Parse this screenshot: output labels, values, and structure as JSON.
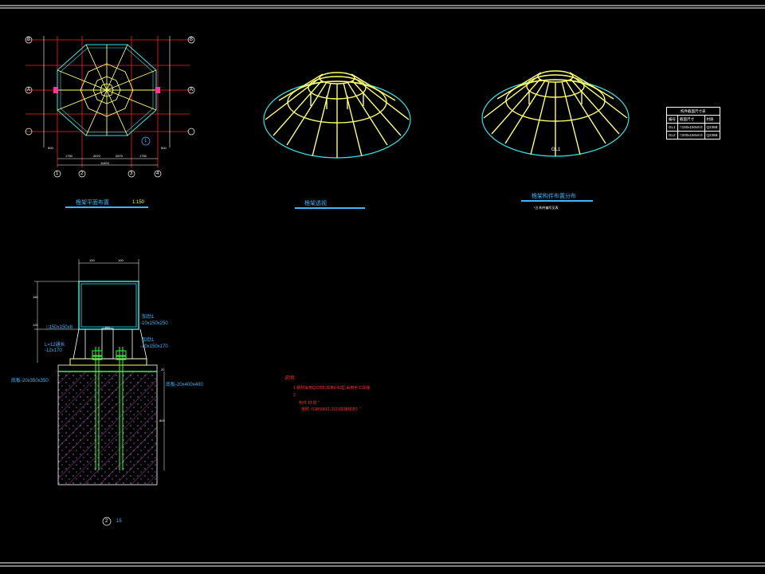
{
  "colors": {
    "background": "#000000",
    "grid_line": "#ff0000",
    "structure": "#ffff66",
    "outline": "#2ee6e6",
    "text": "#ffffff",
    "title": "#3fb6ff",
    "note": "#ff3030",
    "hatch": "#ff66ff",
    "bolt": "#33ff33"
  },
  "plan": {
    "title": "桅架平面布置",
    "scale": "1:150",
    "axis_letters": [
      "B",
      "A",
      "A",
      "B"
    ],
    "axis_numbers": [
      "1",
      "2",
      "3",
      "4"
    ],
    "dim_top": [
      "1750",
      "2870",
      "2870",
      "1750"
    ],
    "dim_bottom": [
      "1750",
      "2870",
      "2870",
      "1750"
    ],
    "dim_overall": "11500",
    "dim_left": [
      "1750",
      "1500",
      "2870",
      "1750"
    ],
    "dim_small_left": "500",
    "dim_small_right": "500",
    "detail_callout": "1"
  },
  "view3d_left": {
    "title": "桅架透视"
  },
  "view3d_right": {
    "title": "桅架构件布置分布",
    "subtitle": "*注:构件编号见表",
    "member_label": "GL1"
  },
  "table": {
    "title": "构件截面尺寸表",
    "headers": [
      "编号",
      "截面尺寸",
      "材质"
    ],
    "rows": [
      [
        "GL1",
        "□150x150x8.0",
        "Q235B"
      ],
      [
        "GL2",
        "□200x150x8.0",
        "Q235B"
      ]
    ]
  },
  "detail": {
    "dim_top": [
      "100",
      "100"
    ],
    "dim_left": [
      "180",
      "120"
    ],
    "dim_height": "800",
    "label_tube": "□150x150x8",
    "label_weld": "L=12通长",
    "label_plate": "-12x170",
    "label_stiff1": "加劲1",
    "label_stiff1b": "-10x150x250",
    "label_stiff2": "加劲1",
    "label_stiff2b": "-10x150x170",
    "label_base_left": "底板-20x350x350",
    "label_base_right": "底板-20x400x400",
    "dim_small": "20",
    "dim_plate": "160",
    "callout": "2",
    "callout_scale": "15"
  },
  "notes": {
    "heading": "说明:",
    "lines": [
      "1.钢材采用Q235B,焊条E43型,采用手工焊接",
      "2.",
      "构件 材       防 \"",
      "按照《GB50661-2011焊接规范》\""
    ]
  }
}
